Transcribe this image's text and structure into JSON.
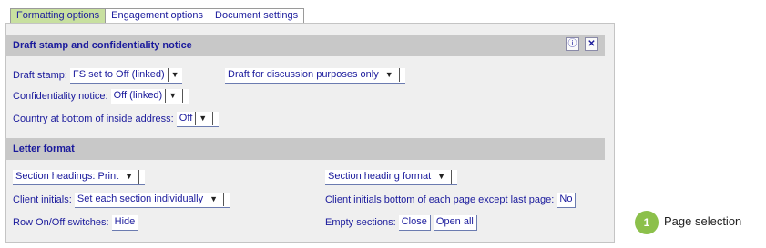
{
  "tabs": [
    {
      "label": "Formatting options",
      "active": true
    },
    {
      "label": "Engagement options",
      "active": false
    },
    {
      "label": "Document settings",
      "active": false
    }
  ],
  "draft_section": {
    "title": "Draft stamp and confidentiality notice",
    "info_icon": "info-icon",
    "close_icon": "close-icon",
    "draft_stamp_label": "Draft stamp:",
    "draft_stamp_value": "FS set to Off (linked)",
    "draft_discussion_value": "Draft for discussion purposes only",
    "confidentiality_label": "Confidentiality notice:",
    "confidentiality_value": "Off (linked)",
    "country_label": "Country at bottom of inside address:",
    "country_value": "Off"
  },
  "letter_section": {
    "title": "Letter format",
    "section_headings_value": "Section headings: Print",
    "section_heading_format_value": "Section heading format",
    "client_initials_label": "Client initials:",
    "client_initials_value": "Set each section individually",
    "client_initials_bottom_label": "Client initials bottom of each page except last page:",
    "client_initials_bottom_value": "No",
    "row_switches_label": "Row On/Off switches:",
    "row_switches_value": "Hide",
    "empty_sections_label": "Empty sections:",
    "empty_close": "Close",
    "empty_open_all": "Open all"
  },
  "callout": {
    "number": "1",
    "label": "Page selection",
    "color": "#8cc04b"
  }
}
